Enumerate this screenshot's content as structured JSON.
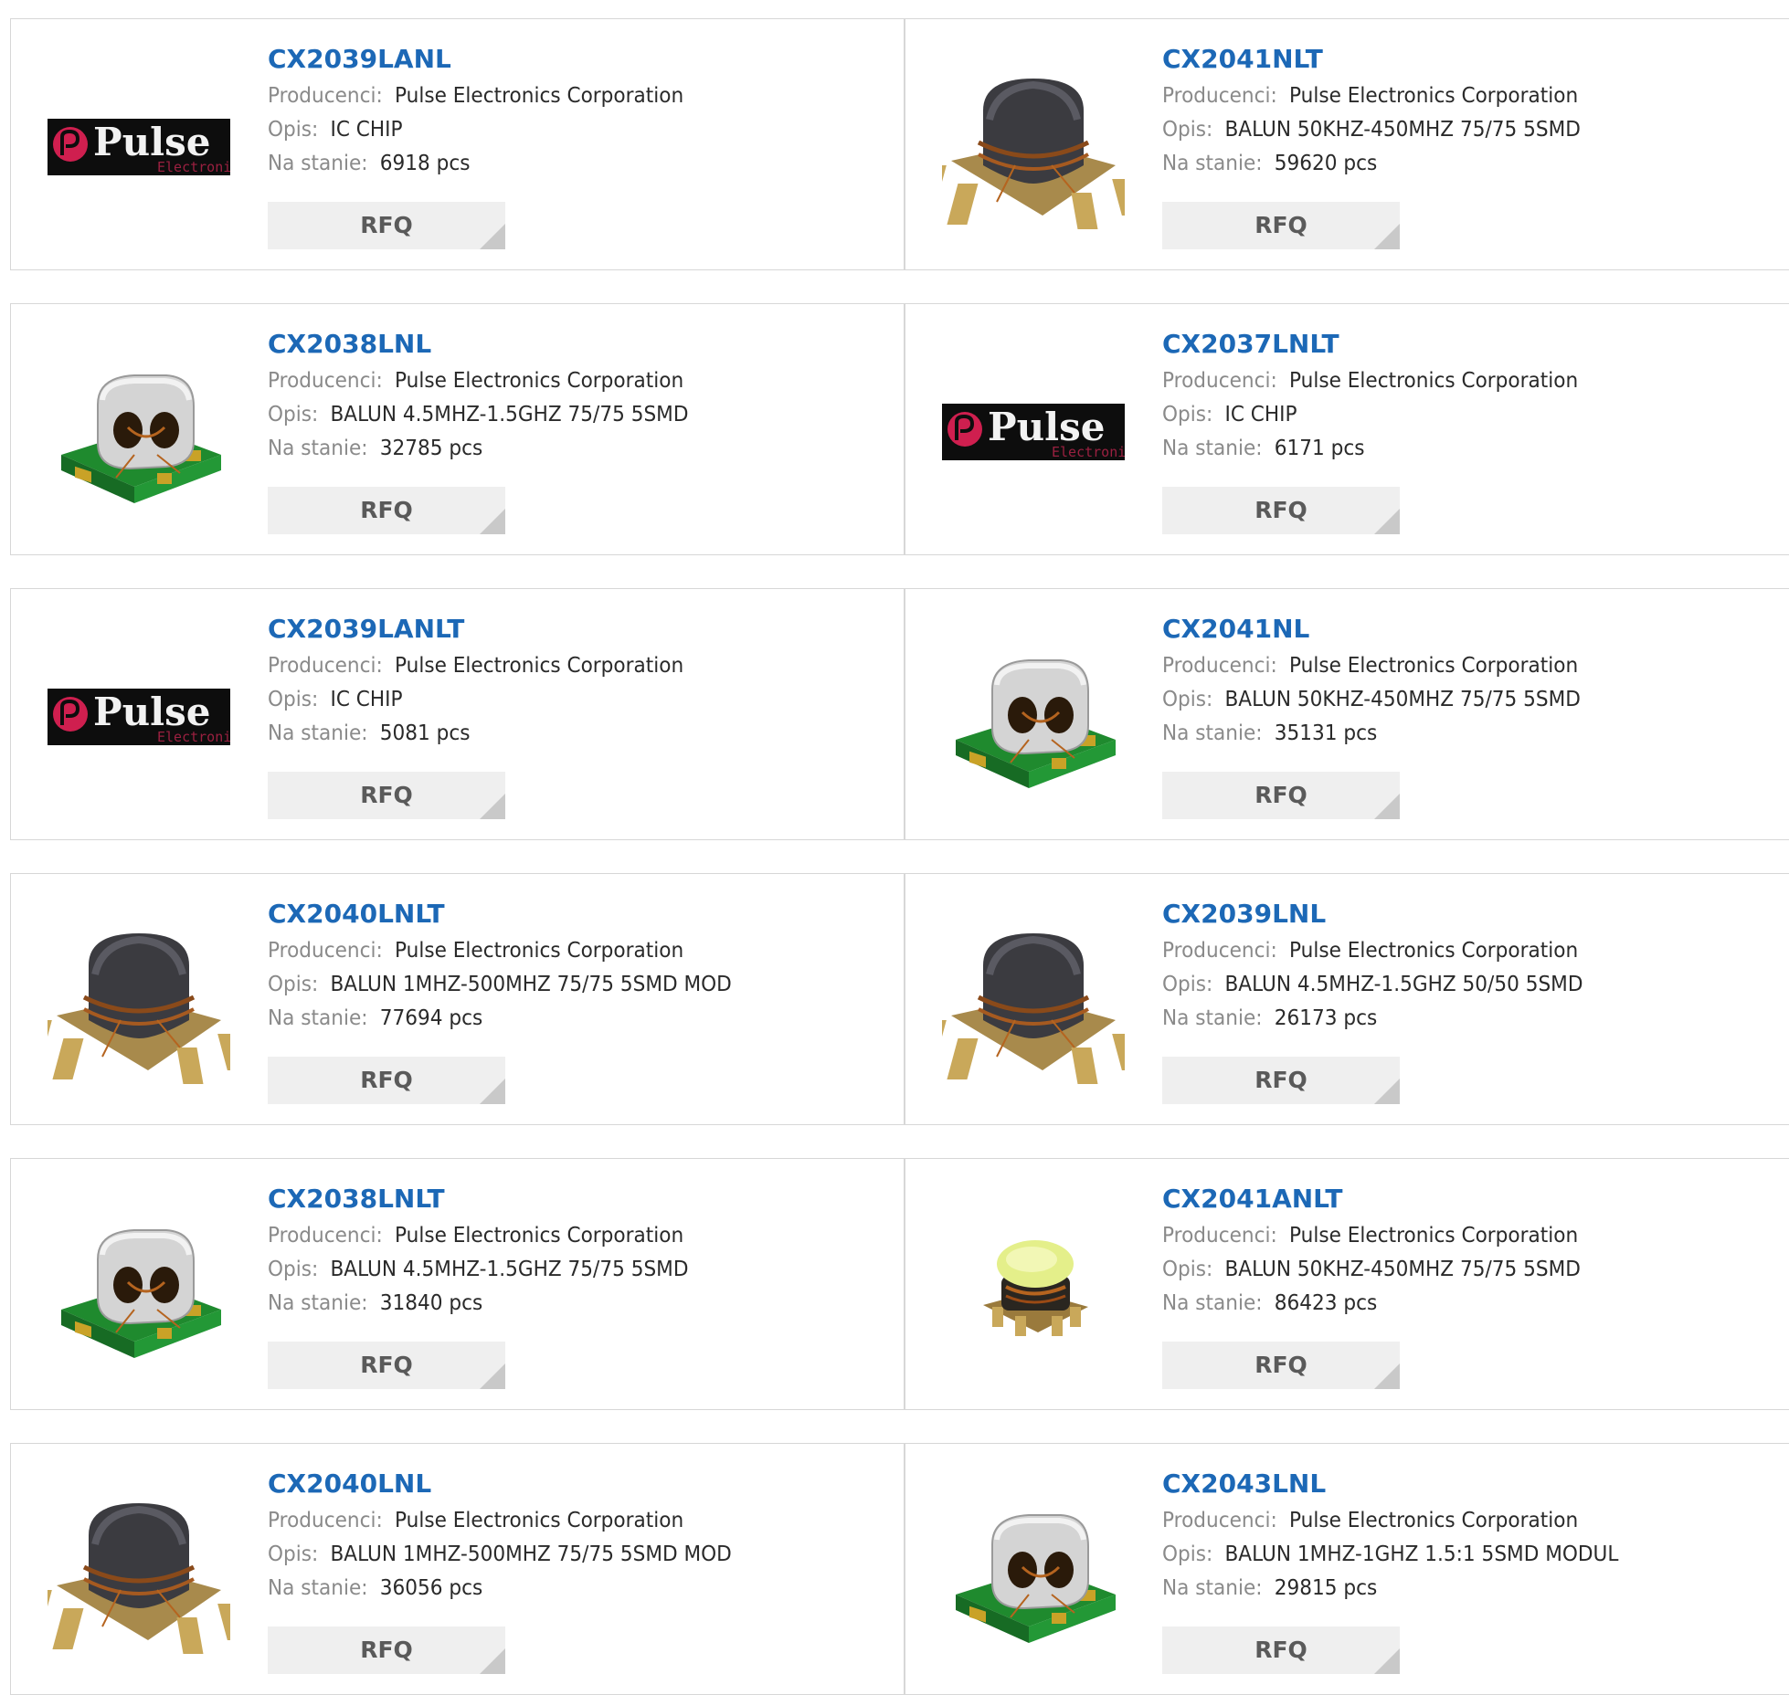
{
  "field_labels": {
    "manufacturer": "Producenci:",
    "description": "Opis:",
    "stock": "Na stanie:"
  },
  "rfq_label": "RFQ",
  "logo_text": {
    "main": "Pulse",
    "sub": "Electronics"
  },
  "products": [
    {
      "part": "CX2039LANL",
      "manufacturer": "Pulse Electronics Corporation",
      "description": "IC CHIP",
      "stock": "6918 pcs",
      "image": "pulse-logo"
    },
    {
      "part": "CX2041NLT",
      "manufacturer": "Pulse Electronics Corporation",
      "description": "BALUN 50KHZ-450MHZ 75/75 5SMD",
      "stock": "59620 pcs",
      "image": "dark-ferrite-balun"
    },
    {
      "part": "CX2038LNL",
      "manufacturer": "Pulse Electronics Corporation",
      "description": "BALUN 4.5MHZ-1.5GHZ 75/75 5SMD",
      "stock": "32785 pcs",
      "image": "gray-binocular-balun"
    },
    {
      "part": "CX2037LNLT",
      "manufacturer": "Pulse Electronics Corporation",
      "description": "IC CHIP",
      "stock": "6171 pcs",
      "image": "pulse-logo"
    },
    {
      "part": "CX2039LANLT",
      "manufacturer": "Pulse Electronics Corporation",
      "description": "IC CHIP",
      "stock": "5081 pcs",
      "image": "pulse-logo"
    },
    {
      "part": "CX2041NL",
      "manufacturer": "Pulse Electronics Corporation",
      "description": "BALUN 50KHZ-450MHZ 75/75 5SMD",
      "stock": "35131 pcs",
      "image": "gray-binocular-balun"
    },
    {
      "part": "CX2040LNLT",
      "manufacturer": "Pulse Electronics Corporation",
      "description": "BALUN 1MHZ-500MHZ 75/75 5SMD MOD",
      "stock": "77694 pcs",
      "image": "dark-ferrite-balun"
    },
    {
      "part": "CX2039LNL",
      "manufacturer": "Pulse Electronics Corporation",
      "description": "BALUN 4.5MHZ-1.5GHZ 50/50 5SMD",
      "stock": "26173 pcs",
      "image": "dark-ferrite-balun"
    },
    {
      "part": "CX2038LNLT",
      "manufacturer": "Pulse Electronics Corporation",
      "description": "BALUN 4.5MHZ-1.5GHZ 75/75 5SMD",
      "stock": "31840 pcs",
      "image": "gray-binocular-balun"
    },
    {
      "part": "CX2041ANLT",
      "manufacturer": "Pulse Electronics Corporation",
      "description": "BALUN 50KHZ-450MHZ 75/75 5SMD",
      "stock": "86423 pcs",
      "image": "yellow-cap-balun"
    },
    {
      "part": "CX2040LNL",
      "manufacturer": "Pulse Electronics Corporation",
      "description": "BALUN 1MHZ-500MHZ 75/75 5SMD MOD",
      "stock": "36056 pcs",
      "image": "dark-ferrite-balun"
    },
    {
      "part": "CX2043LNL",
      "manufacturer": "Pulse Electronics Corporation",
      "description": "BALUN 1MHZ-1GHZ 1.5:1 5SMD MODUL",
      "stock": "29815 pcs",
      "image": "gray-binocular-balun"
    }
  ]
}
